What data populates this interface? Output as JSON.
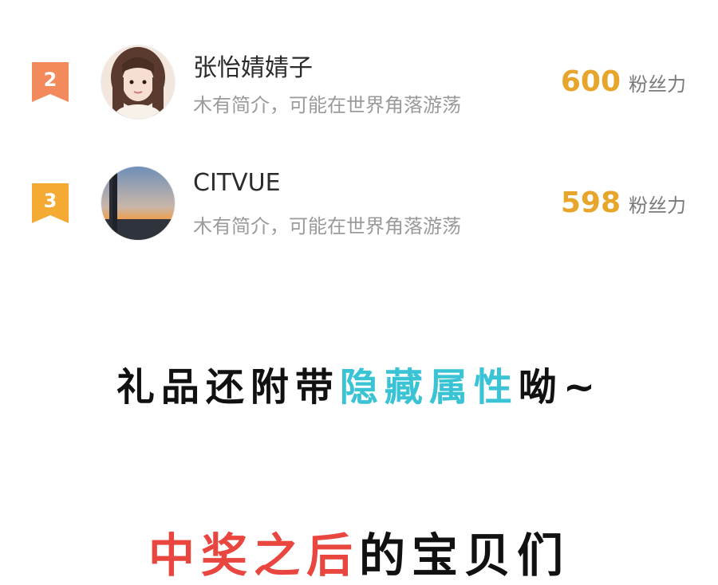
{
  "leaderboard": {
    "entries": [
      {
        "rank": "2",
        "name": "张怡婧婧子",
        "bio": "木有简介，可能在世界角落游荡",
        "score": "600",
        "score_unit": "粉丝力",
        "badge_color": "#f28a5b",
        "avatar": "avatar-photo-girl"
      },
      {
        "rank": "3",
        "name": "CITVUE",
        "bio": "木有简介，可能在世界角落游荡",
        "score": "598",
        "score_unit": "粉丝力",
        "badge_color": "#f5aa33",
        "avatar": "avatar-photo-sunset"
      }
    ],
    "score_color": "#e7a52b"
  },
  "caption": {
    "part1": "礼品还附带",
    "highlight": "隐藏属性",
    "part2": "呦~",
    "highlight_color": "#39c3d4"
  },
  "footer": {
    "red_text": "中奖之后",
    "dark_text": "的宝贝们",
    "red_color": "#e8463f"
  }
}
